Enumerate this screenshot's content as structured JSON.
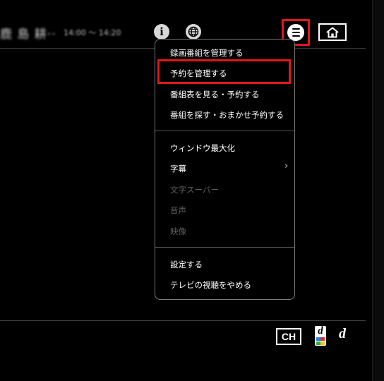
{
  "program": {
    "title": "鹿 島 耕··",
    "time": "14:00 〜 14:20"
  },
  "header": {
    "info_icon": "info-icon",
    "globe_icon": "globe-icon",
    "menu_icon": "menu-icon",
    "home_icon": "home-icon"
  },
  "menu": {
    "items": [
      {
        "label": "録画番組を管理する",
        "enabled": true
      },
      {
        "label": "予約を管理する",
        "enabled": true,
        "highlighted": true
      },
      {
        "label": "番組表を見る・予約する",
        "enabled": true
      },
      {
        "label": "番組を探す・おまかせ予約する",
        "enabled": true
      },
      {
        "label": "ウィンドウ最大化",
        "enabled": true
      },
      {
        "label": "字幕",
        "enabled": true,
        "submenu": true
      },
      {
        "label": "文字スーパー",
        "enabled": false
      },
      {
        "label": "音声",
        "enabled": false
      },
      {
        "label": "映像",
        "enabled": false
      },
      {
        "label": "設定する",
        "enabled": true
      },
      {
        "label": "テレビの視聴をやめる",
        "enabled": true
      }
    ],
    "submenu_icon": "chevron-right-icon"
  },
  "footer": {
    "ch_label": "CH",
    "data_label": "d",
    "d_label": "d"
  },
  "colors": {
    "background": "#000000",
    "highlight": "#e0161c",
    "text": "#ffffff",
    "disabled": "#5e5e5e",
    "border": "#777777"
  }
}
